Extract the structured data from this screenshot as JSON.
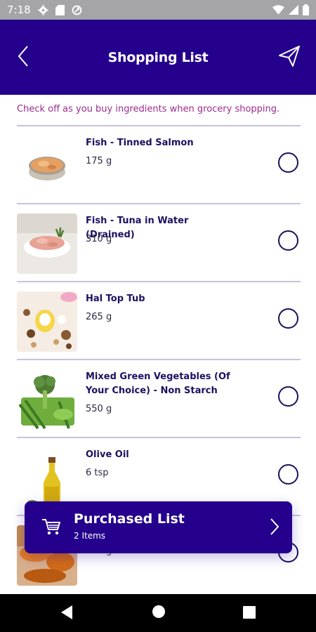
{
  "status_bar": {
    "time": "7:18",
    "icons": [
      "settings-icon",
      "sd-card-icon",
      "sync-icon",
      "wifi-icon",
      "signal-icon",
      "battery-icon"
    ]
  },
  "header": {
    "title": "Shopping List",
    "back_icon": "back-arrow-icon",
    "send_icon": "send-icon"
  },
  "instruction": "Check off as you buy ingredients when grocery shopping.",
  "items": [
    {
      "name": "Fish - Tinned Salmon",
      "quantity": "175 g",
      "image": "tinned-salmon-image",
      "checked": false
    },
    {
      "name": "Fish - Tuna in Water (Drained)",
      "quantity": "310 g",
      "image": "tuna-image",
      "checked": false
    },
    {
      "name": "Hal Top Tub",
      "quantity": "265 g",
      "image": "halo-top-tub-image",
      "checked": false
    },
    {
      "name": "Mixed Green Vegetables (Of Your Choice) - Non Starch",
      "quantity": "550 g",
      "image": "green-vegetables-image",
      "checked": false
    },
    {
      "name": "Olive Oil",
      "quantity": "6 tsp",
      "image": "olive-oil-image",
      "checked": false
    },
    {
      "name": "",
      "quantity": "200 g",
      "image": "food-image",
      "checked": false
    }
  ],
  "purchased_bar": {
    "title": "Purchased List",
    "count": "2 Items",
    "icon": "cart-icon"
  },
  "colors": {
    "primary": "#24008c",
    "instruction_text": "#9c2a8e",
    "status_bar": "#a5a5a7"
  }
}
